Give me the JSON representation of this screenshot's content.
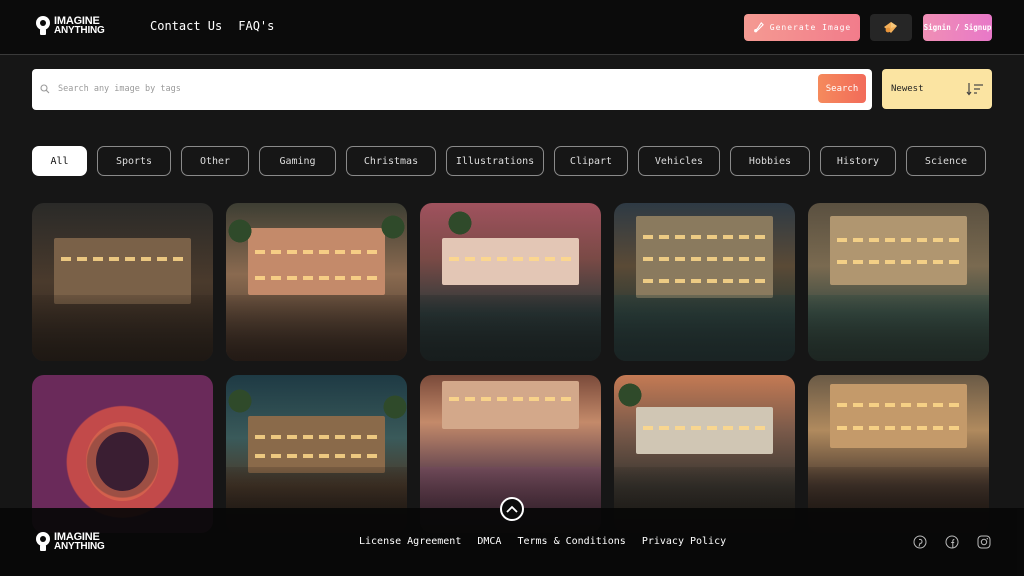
{
  "header": {
    "logo_line1": "IMAGINE",
    "logo_line2": "ANYTHING",
    "nav": [
      "Contact Us",
      "FAQ's"
    ],
    "generate_label": "Generate Image",
    "signin_label": "Signin / Signup"
  },
  "search": {
    "placeholder": "Search any image by tags",
    "button_label": "Search",
    "sort_label": "Newest"
  },
  "categories": [
    "All",
    "Sports",
    "Other",
    "Gaming",
    "Christmas",
    "Illustrations",
    "Clipart",
    "Vehicles",
    "Hobbies",
    "History",
    "Science"
  ],
  "active_category": "All",
  "footer": {
    "logo_line1": "IMAGINE",
    "logo_line2": "ANYTHING",
    "links": [
      "License Agreement",
      "DMCA",
      "Terms & Conditions",
      "Privacy Policy"
    ],
    "social": [
      "pinterest-icon",
      "facebook-icon",
      "instagram-icon"
    ]
  },
  "colors": {
    "accent_generate": "#f49a92",
    "accent_search": "#f58a5c",
    "sort_bg": "#fbe4a2",
    "signin": "#e878c8"
  }
}
